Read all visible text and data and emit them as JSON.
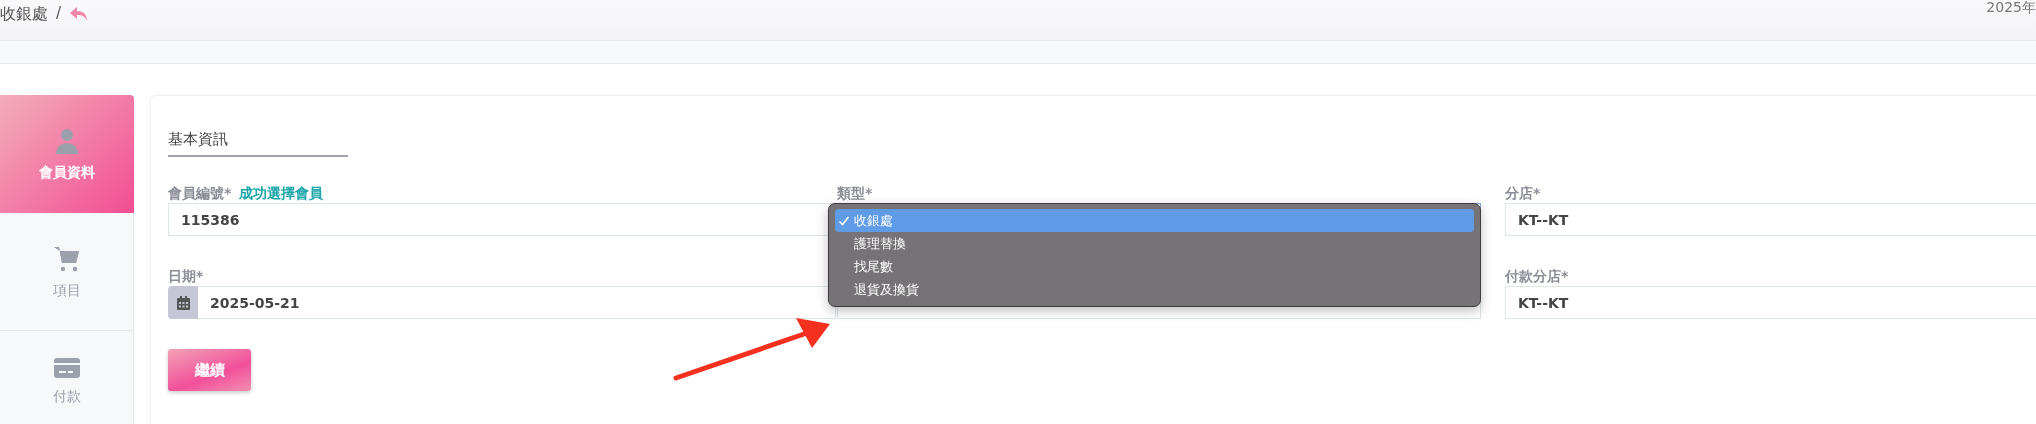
{
  "header": {
    "breadcrumb": "收銀處",
    "separator": "/",
    "date": "2025年"
  },
  "sidebar": {
    "items": [
      {
        "kind": "member",
        "label": "會員資料",
        "selected": true
      },
      {
        "kind": "cart",
        "label": "項目",
        "selected": false
      },
      {
        "kind": "card",
        "label": "付款",
        "selected": false
      }
    ]
  },
  "form": {
    "section_title": "基本資訊",
    "fields": [
      {
        "kind": "text",
        "label": "會員編號*",
        "note": "成功選擇會員",
        "value": "115386"
      },
      {
        "kind": "select",
        "label": "類型*",
        "open": true
      },
      {
        "kind": "text",
        "label": "分店*",
        "value": "KT--KT"
      },
      {
        "kind": "date",
        "label": "日期*",
        "value": "2025-05-21"
      },
      {
        "kind": "text"
      },
      {
        "kind": "text",
        "label": "付款分店*",
        "value": "KT--KT"
      }
    ],
    "continue_button": "繼續"
  },
  "dropdown": {
    "options": [
      {
        "label": "收銀處",
        "selected": true
      },
      {
        "label": "護理替換",
        "selected": false
      },
      {
        "label": "找尾數",
        "selected": false
      },
      {
        "label": "退貨及換貨",
        "selected": false
      }
    ]
  }
}
